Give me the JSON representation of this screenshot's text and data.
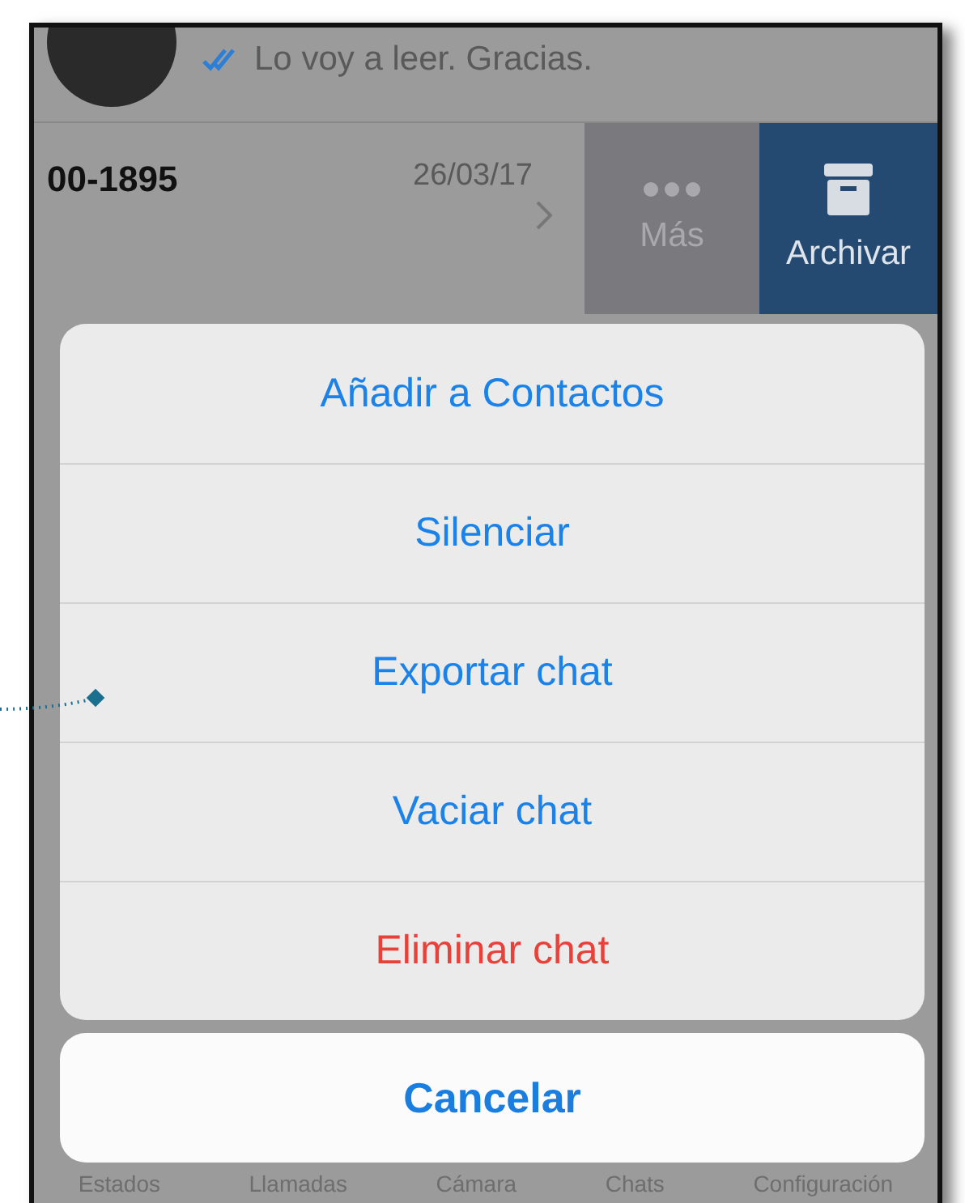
{
  "chat_list": {
    "rows": [
      {
        "message": "Lo voy a leer. Gracias.",
        "read": true
      },
      {
        "name": "00-1895",
        "date": "26/03/17"
      }
    ],
    "swipe_actions": [
      {
        "label": "Más",
        "kind": "more"
      },
      {
        "label": "Archivar",
        "kind": "archive"
      }
    ]
  },
  "action_sheet": {
    "actions": [
      {
        "label": "Añadir a Contactos",
        "kind": "default"
      },
      {
        "label": "Silenciar",
        "kind": "default"
      },
      {
        "label": "Exportar chat",
        "kind": "default"
      },
      {
        "label": "Vaciar chat",
        "kind": "default"
      },
      {
        "label": "Eliminar chat",
        "kind": "destructive"
      }
    ],
    "cancel": "Cancelar"
  },
  "tab_bar": [
    "Estados",
    "Llamadas",
    "Cámara",
    "Chats",
    "Configuración"
  ]
}
